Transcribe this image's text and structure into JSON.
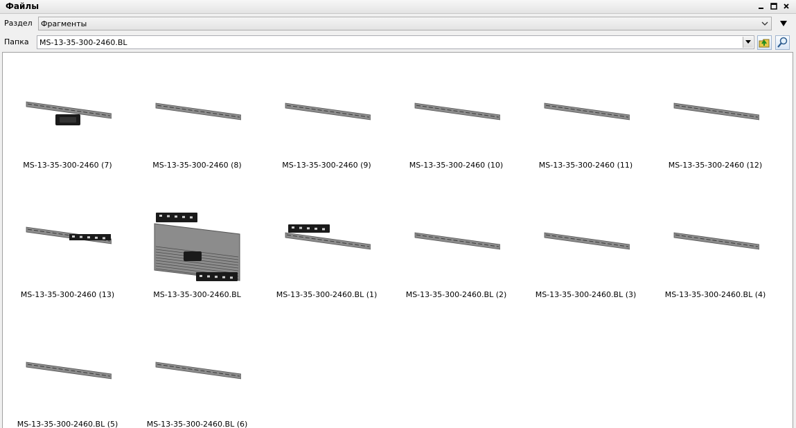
{
  "window": {
    "title": "Файлы"
  },
  "section": {
    "label": "Раздел",
    "value": "Фрагменты"
  },
  "folder": {
    "label": "Папка",
    "value": "MS-13-35-300-2460.BL"
  },
  "files": [
    {
      "name": "MS-13-35-300-2460 (7)",
      "thumbnail": "bar-with-center-block"
    },
    {
      "name": "MS-13-35-300-2460 (8)",
      "thumbnail": "plain-bar"
    },
    {
      "name": "MS-13-35-300-2460 (9)",
      "thumbnail": "plain-bar"
    },
    {
      "name": "MS-13-35-300-2460 (10)",
      "thumbnail": "plain-bar"
    },
    {
      "name": "MS-13-35-300-2460 (11)",
      "thumbnail": "plain-bar"
    },
    {
      "name": "MS-13-35-300-2460 (12)",
      "thumbnail": "plain-bar"
    },
    {
      "name": "MS-13-35-300-2460 (13)",
      "thumbnail": "bar-with-right-holes"
    },
    {
      "name": "MS-13-35-300-2460.BL",
      "thumbnail": "panel-assembly"
    },
    {
      "name": "MS-13-35-300-2460.BL (1)",
      "thumbnail": "bar-with-left-holes"
    },
    {
      "name": "MS-13-35-300-2460.BL (2)",
      "thumbnail": "plain-bar"
    },
    {
      "name": "MS-13-35-300-2460.BL (3)",
      "thumbnail": "plain-bar"
    },
    {
      "name": "MS-13-35-300-2460.BL (4)",
      "thumbnail": "plain-bar"
    },
    {
      "name": "MS-13-35-300-2460.BL (5)",
      "thumbnail": "plain-bar"
    },
    {
      "name": "MS-13-35-300-2460.BL (6)",
      "thumbnail": "plain-bar"
    }
  ],
  "colors": {
    "part_fill": "#8c8c8c",
    "part_dark": "#1a1a1a",
    "part_edge": "#555555"
  }
}
